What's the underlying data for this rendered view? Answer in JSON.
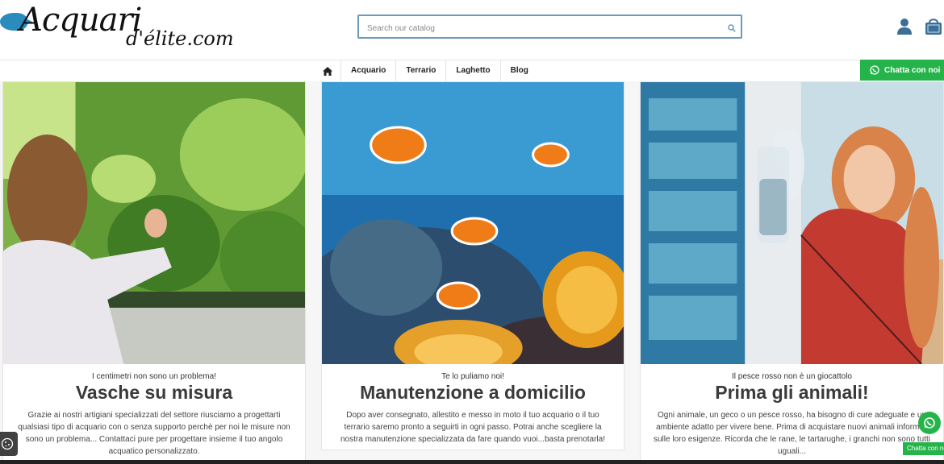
{
  "header": {
    "logo_main": "Acquari",
    "logo_sub": "d'élite.com",
    "search_placeholder": "Search our catalog"
  },
  "nav": {
    "items": [
      "Acquario",
      "Terrario",
      "Laghetto",
      "Blog"
    ],
    "chat_label": "Chatta con noi"
  },
  "cards": [
    {
      "kicker": "I centimetri non sono un problema!",
      "title": "Vasche su misura",
      "desc": "Grazie ai nostri artigiani specializzati del settore riusciamo a progettarti qualsiasi tipo di acquario con o senza supporto perchè per noi le misure non sono un problema... Contattaci pure per progettare insieme il tuo angolo acquatico personalizzato."
    },
    {
      "kicker": "Te lo puliamo noi!",
      "title": "Manutenzione a domicilio",
      "desc": "Dopo aver consegnato, allestito e messo in moto il tuo acquario o il tuo terrario saremo pronto a seguirti in ogni passo. Potrai anche scegliere la nostra manutenzione specializzata da fare quando vuoi...basta prenotarla!"
    },
    {
      "kicker": "Il pesce rosso non è un giocattolo",
      "title": "Prima gli animali!",
      "desc": "Ogni animale, un geco o un pesce rosso, ha bisogno di cure adeguate e un ambiente adatto per vivere bene. Prima di acquistare nuovi animali informati sulle loro esigenze. Ricorda che le rane, le tartarughe, i granchi non sono tutti uguali..."
    }
  ],
  "floating": {
    "chat_tab": "Chatta con noi"
  },
  "colors": {
    "accent_green": "#25b44a",
    "search_border": "#6b9ab8",
    "icon_blue": "#3b6f98"
  }
}
